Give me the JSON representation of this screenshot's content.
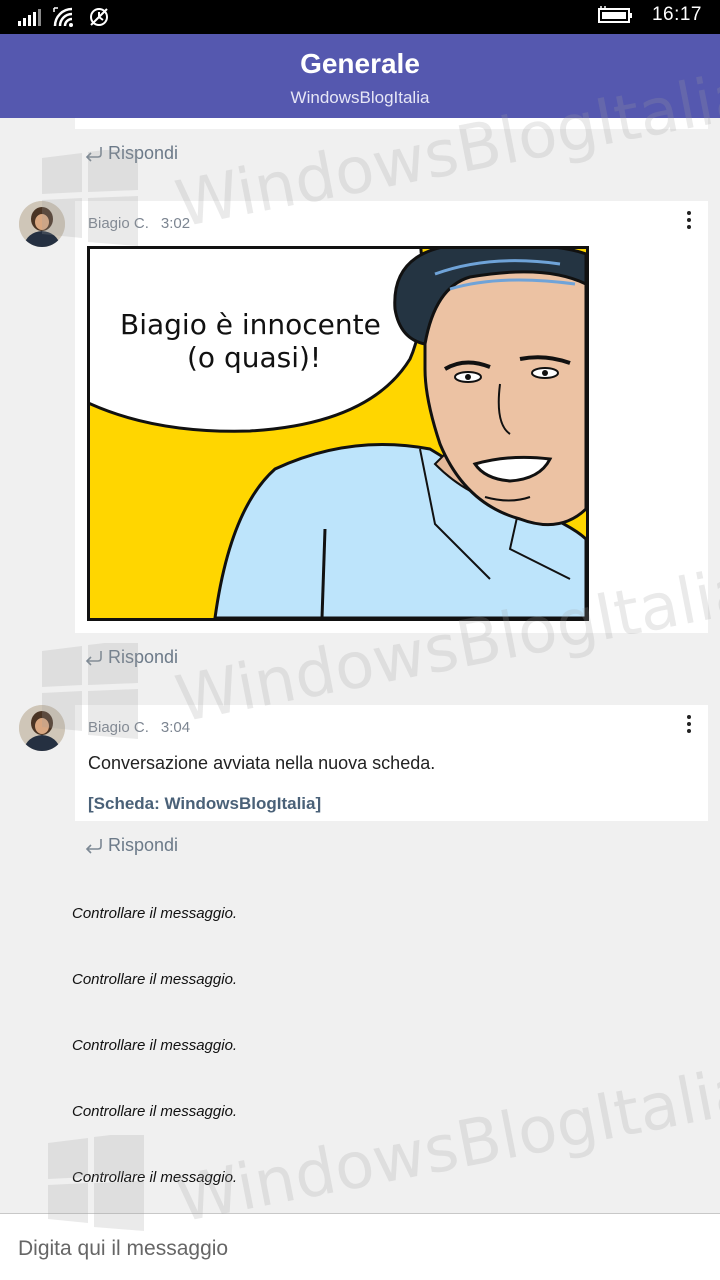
{
  "status_bar": {
    "time": "16:17",
    "icons": [
      "signal-icon",
      "wifi-icon",
      "quiet-hours-icon",
      "battery-icon"
    ]
  },
  "header": {
    "title": "Generale",
    "subtitle": "WindowsBlogItalia"
  },
  "replies": {
    "label": "Rispondi"
  },
  "messages": [
    {
      "author": "Biagio C.",
      "time": "3:02",
      "image_caption": "Biagio è innocente\n(o quasi)!"
    },
    {
      "author": "Biagio C.",
      "time": "3:04",
      "text": "Conversazione avviata nella nuova scheda.",
      "link": "[Scheda: WindowsBlogItalia]"
    }
  ],
  "system_messages": [
    "Controllare il messaggio.",
    "Controllare il messaggio.",
    "Controllare il messaggio.",
    "Controllare il messaggio.",
    "Controllare il messaggio."
  ],
  "composer": {
    "placeholder": "Digita qui il messaggio"
  },
  "watermark": "WindowsBlogItalia",
  "colors": {
    "header": "#5558af",
    "background": "#f0f0f0",
    "comic_yellow": "#ffd600",
    "shirt": "#bde4fb"
  }
}
